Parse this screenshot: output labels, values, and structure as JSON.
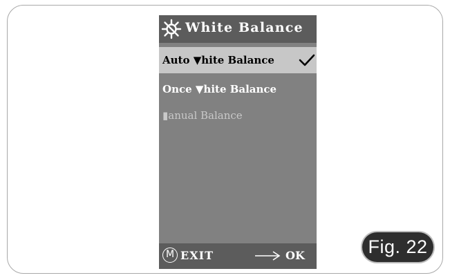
{
  "screen": {
    "header": {
      "icon": "sun-gear-icon",
      "title": "White Balance"
    },
    "menu": {
      "items": [
        {
          "label": "Auto ▼hite Balance",
          "selected": true,
          "checked": true
        },
        {
          "label": "Once ▼hite Balance",
          "selected": false,
          "checked": false
        },
        {
          "label": "▮anual Balance",
          "selected": false,
          "checked": false,
          "disabled": true
        }
      ],
      "check_icon": "checkmark-icon"
    },
    "footer": {
      "menu_key": "M",
      "exit_label": "EXIT",
      "arrow_icon": "right-arrow-icon",
      "ok_label": "OK"
    }
  },
  "figure_label": "Fig. 22",
  "colors": {
    "screen_bg": "#818181",
    "header_bg": "#5c5c5c",
    "selected_bg": "#c7c7c7",
    "disabled_text": "#c9c9c9",
    "badge_bg": "#2e2e2e"
  }
}
